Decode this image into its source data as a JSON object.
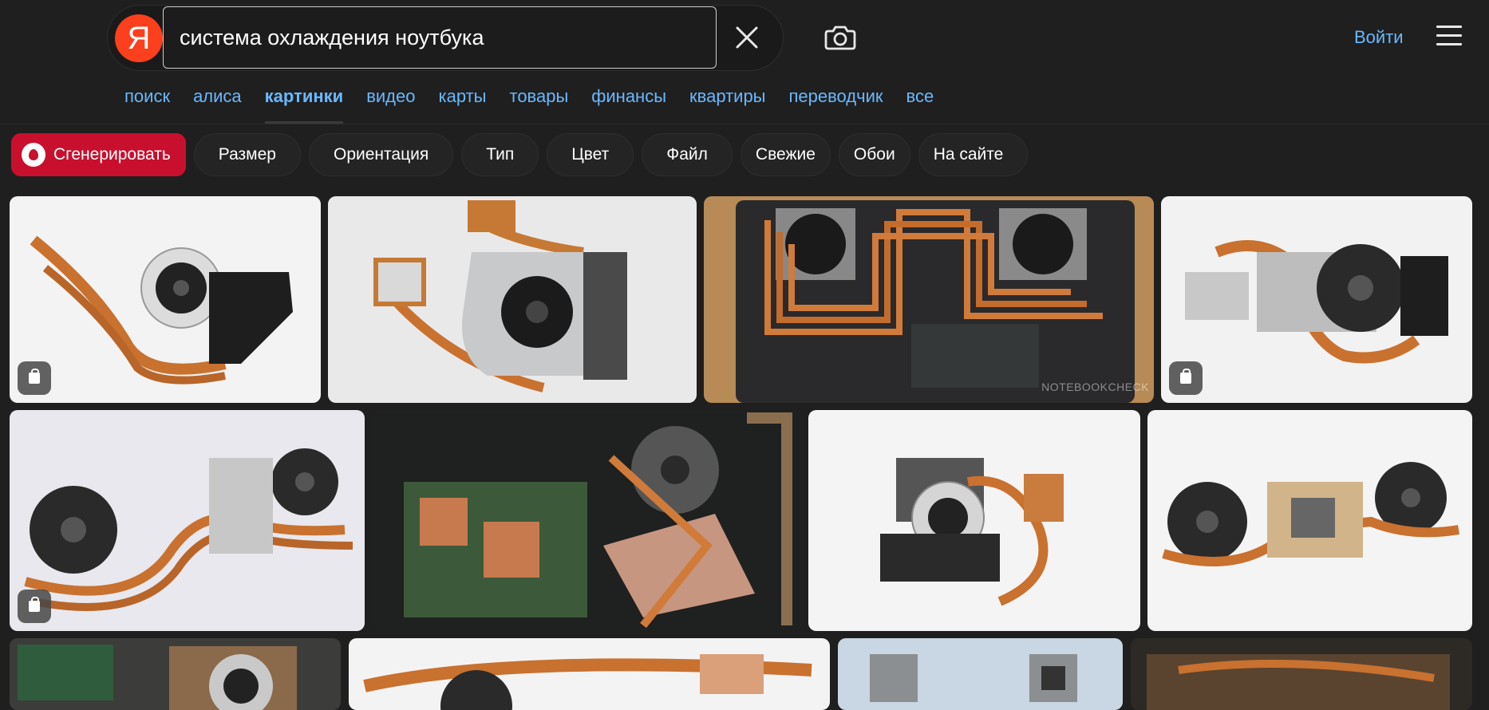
{
  "logo": {
    "letter": "Я"
  },
  "search": {
    "value": "система охлаждения ноутбука",
    "placeholder": ""
  },
  "header": {
    "login_label": "Войти"
  },
  "nav": {
    "tabs": [
      {
        "label": "поиск"
      },
      {
        "label": "алиса"
      },
      {
        "label": "картинки",
        "active": true
      },
      {
        "label": "видео"
      },
      {
        "label": "карты"
      },
      {
        "label": "товары"
      },
      {
        "label": "финансы"
      },
      {
        "label": "квартиры"
      },
      {
        "label": "переводчик"
      },
      {
        "label": "все"
      }
    ]
  },
  "filters": {
    "generate_label": "Сгенерировать",
    "items": [
      "Размер",
      "Ориентация",
      "Тип",
      "Цвет",
      "Файл",
      "Свежие",
      "Обои",
      "На сайте"
    ]
  },
  "images": [
    {
      "subject": "cooler-white-bg",
      "shop_badge": true
    },
    {
      "subject": "cooler-heatsink-silver",
      "shop_badge": false
    },
    {
      "subject": "laptop-dual-fan-installed",
      "shop_badge": false,
      "watermark": "NOTEBOOKCHECK"
    },
    {
      "subject": "cooler-white-bg",
      "shop_badge": true
    },
    {
      "subject": "dual-fan-cooler",
      "shop_badge": true
    },
    {
      "subject": "laptop-open-motherboard",
      "shop_badge": false
    },
    {
      "subject": "cooler-white-bg",
      "shop_badge": false
    },
    {
      "subject": "dual-fan-cooler",
      "shop_badge": false
    },
    {
      "subject": "laptop-open-motherboard",
      "shop_badge": false
    },
    {
      "subject": "cooler-white-bg",
      "shop_badge": false
    },
    {
      "subject": "cooler-grid-bg",
      "shop_badge": false
    },
    {
      "subject": "laptop-open-motherboard",
      "shop_badge": false
    }
  ],
  "colors": {
    "accent_link": "#6ab8ff",
    "logo": "#fc3f1d",
    "generate": "#c8102e",
    "copper": "#c9712f"
  }
}
